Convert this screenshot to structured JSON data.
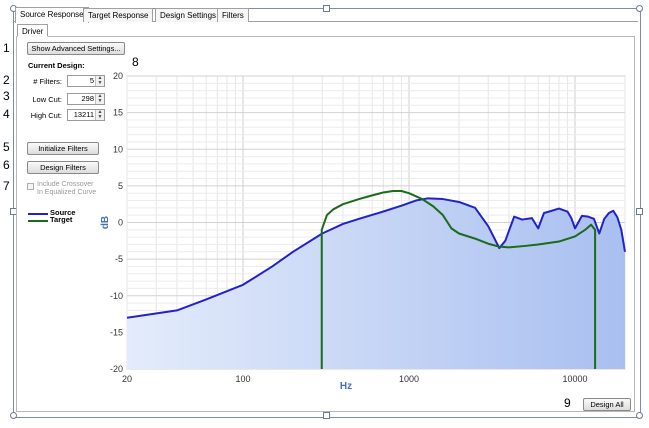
{
  "tabs": [
    "Source Response",
    "Target Response",
    "Design Settings",
    "Filters"
  ],
  "subtab": "Driver",
  "buttons": {
    "advanced": "Show Advanced Settings...",
    "initialize": "Initialize Filters",
    "design": "Design Filters",
    "design_all": "Design All"
  },
  "current_design": {
    "heading": "Current Design:",
    "filters_label": "# Filters:",
    "filters_value": "5",
    "low_cut_label": "Low Cut:",
    "low_cut_value": "298",
    "high_cut_label": "High Cut:",
    "high_cut_value": "13211",
    "include_line1": "Include  Crossover",
    "include_line2": "In Equalized Curve"
  },
  "callouts": [
    "1",
    "2",
    "3",
    "4",
    "5",
    "6",
    "7",
    "8",
    "9"
  ],
  "colors": {
    "source": "#2222cc",
    "target": "#1a6b1a",
    "fill": "#a9bff0"
  },
  "chart_data": {
    "type": "line",
    "xlabel": "Hz",
    "ylabel": "dB",
    "x_scale": "log",
    "xlim": [
      20,
      20000
    ],
    "ylim": [
      -20,
      20
    ],
    "x_ticks": [
      "20",
      "100",
      "1000",
      "10000"
    ],
    "y_ticks": [
      "20",
      "15",
      "10",
      "5",
      "0",
      "-5",
      "-10",
      "-15",
      "-20"
    ],
    "grid": true,
    "legend_placement": "left",
    "series": [
      {
        "name": "Source",
        "points": [
          [
            20,
            -13
          ],
          [
            40,
            -12
          ],
          [
            60,
            -10.5
          ],
          [
            100,
            -8.5
          ],
          [
            150,
            -6
          ],
          [
            200,
            -4
          ],
          [
            300,
            -1.5
          ],
          [
            400,
            -0.2
          ],
          [
            500,
            0.5
          ],
          [
            700,
            1.5
          ],
          [
            900,
            2.3
          ],
          [
            1100,
            3
          ],
          [
            1300,
            3.3
          ],
          [
            1600,
            3.2
          ],
          [
            2000,
            2.8
          ],
          [
            2500,
            2
          ],
          [
            3000,
            -0.5
          ],
          [
            3500,
            -3.5
          ],
          [
            3800,
            -2.5
          ],
          [
            4300,
            0.8
          ],
          [
            4800,
            0.4
          ],
          [
            5500,
            0.6
          ],
          [
            6000,
            -0.8
          ],
          [
            6500,
            1.3
          ],
          [
            7000,
            1.5
          ],
          [
            8000,
            1.9
          ],
          [
            9000,
            1.5
          ],
          [
            9500,
            0.6
          ],
          [
            10000,
            -0.8
          ],
          [
            11000,
            0.9
          ],
          [
            12000,
            0.8
          ],
          [
            13000,
            0.5
          ],
          [
            14000,
            -1.5
          ],
          [
            15000,
            0.5
          ],
          [
            16000,
            1.3
          ],
          [
            17000,
            1.6
          ],
          [
            18000,
            0.7
          ],
          [
            19000,
            -1
          ],
          [
            20000,
            -4
          ]
        ]
      },
      {
        "name": "Target",
        "points": [
          [
            298,
            -20
          ],
          [
            298,
            -1
          ],
          [
            320,
            1
          ],
          [
            350,
            1.8
          ],
          [
            400,
            2.5
          ],
          [
            500,
            3.2
          ],
          [
            600,
            3.7
          ],
          [
            700,
            4.1
          ],
          [
            800,
            4.3
          ],
          [
            900,
            4.3
          ],
          [
            1000,
            4
          ],
          [
            1200,
            3.2
          ],
          [
            1400,
            2.2
          ],
          [
            1600,
            1
          ],
          [
            1800,
            -0.8
          ],
          [
            2000,
            -1.5
          ],
          [
            2500,
            -2.2
          ],
          [
            3000,
            -2.9
          ],
          [
            3500,
            -3.3
          ],
          [
            4000,
            -3.4
          ],
          [
            5000,
            -3.2
          ],
          [
            6000,
            -3
          ],
          [
            8000,
            -2.6
          ],
          [
            10000,
            -1.9
          ],
          [
            11500,
            -1
          ],
          [
            12500,
            -0.3
          ],
          [
            13211,
            -1
          ],
          [
            13211,
            -20
          ]
        ]
      }
    ]
  }
}
